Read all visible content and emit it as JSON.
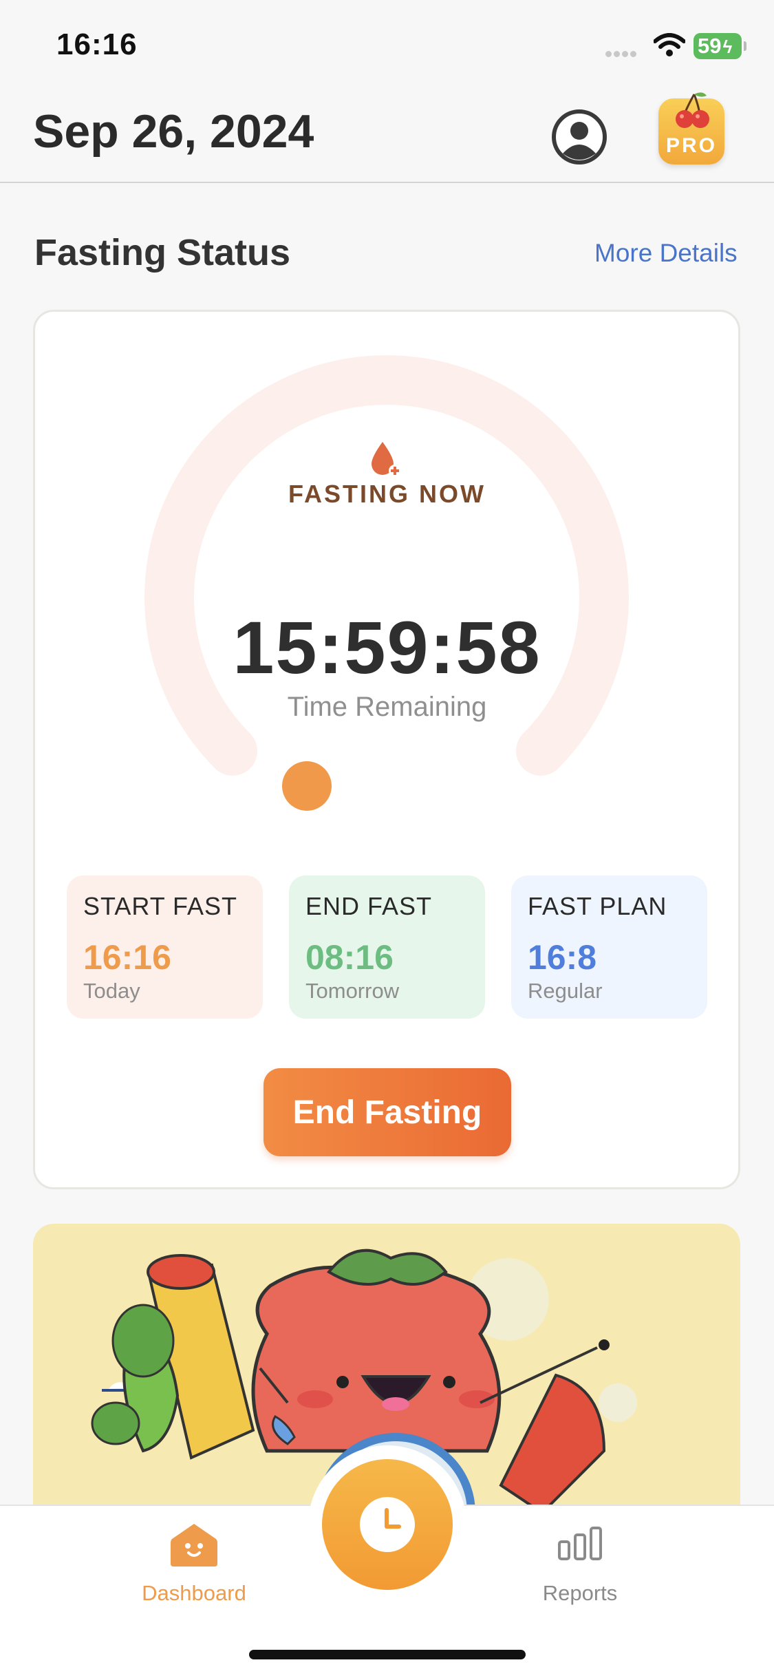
{
  "status_bar": {
    "time": "16:16",
    "battery": "59"
  },
  "header": {
    "date": "Sep 26, 2024",
    "pro_badge": "PRO"
  },
  "section": {
    "title": "Fasting Status",
    "more_link": "More Details"
  },
  "timer": {
    "state": "FASTING NOW",
    "remaining": "15:59:58",
    "remaining_label": "Time Remaining",
    "progress": 0.0
  },
  "info_cards": [
    {
      "label": "START FAST",
      "value": "16:16",
      "sub": "Today"
    },
    {
      "label": "END FAST",
      "value": "08:16",
      "sub": "Tomorrow"
    },
    {
      "label": "FAST PLAN",
      "value": "16:8",
      "sub": "Regular"
    }
  ],
  "action": {
    "end_label": "End Fasting"
  },
  "tabs": {
    "dashboard": "Dashboard",
    "reports": "Reports"
  },
  "colors": {
    "accent": "#f29a33",
    "link": "#4a74c9",
    "ring_track": "#fdf0ec",
    "ring_knob": "#f0994a"
  }
}
